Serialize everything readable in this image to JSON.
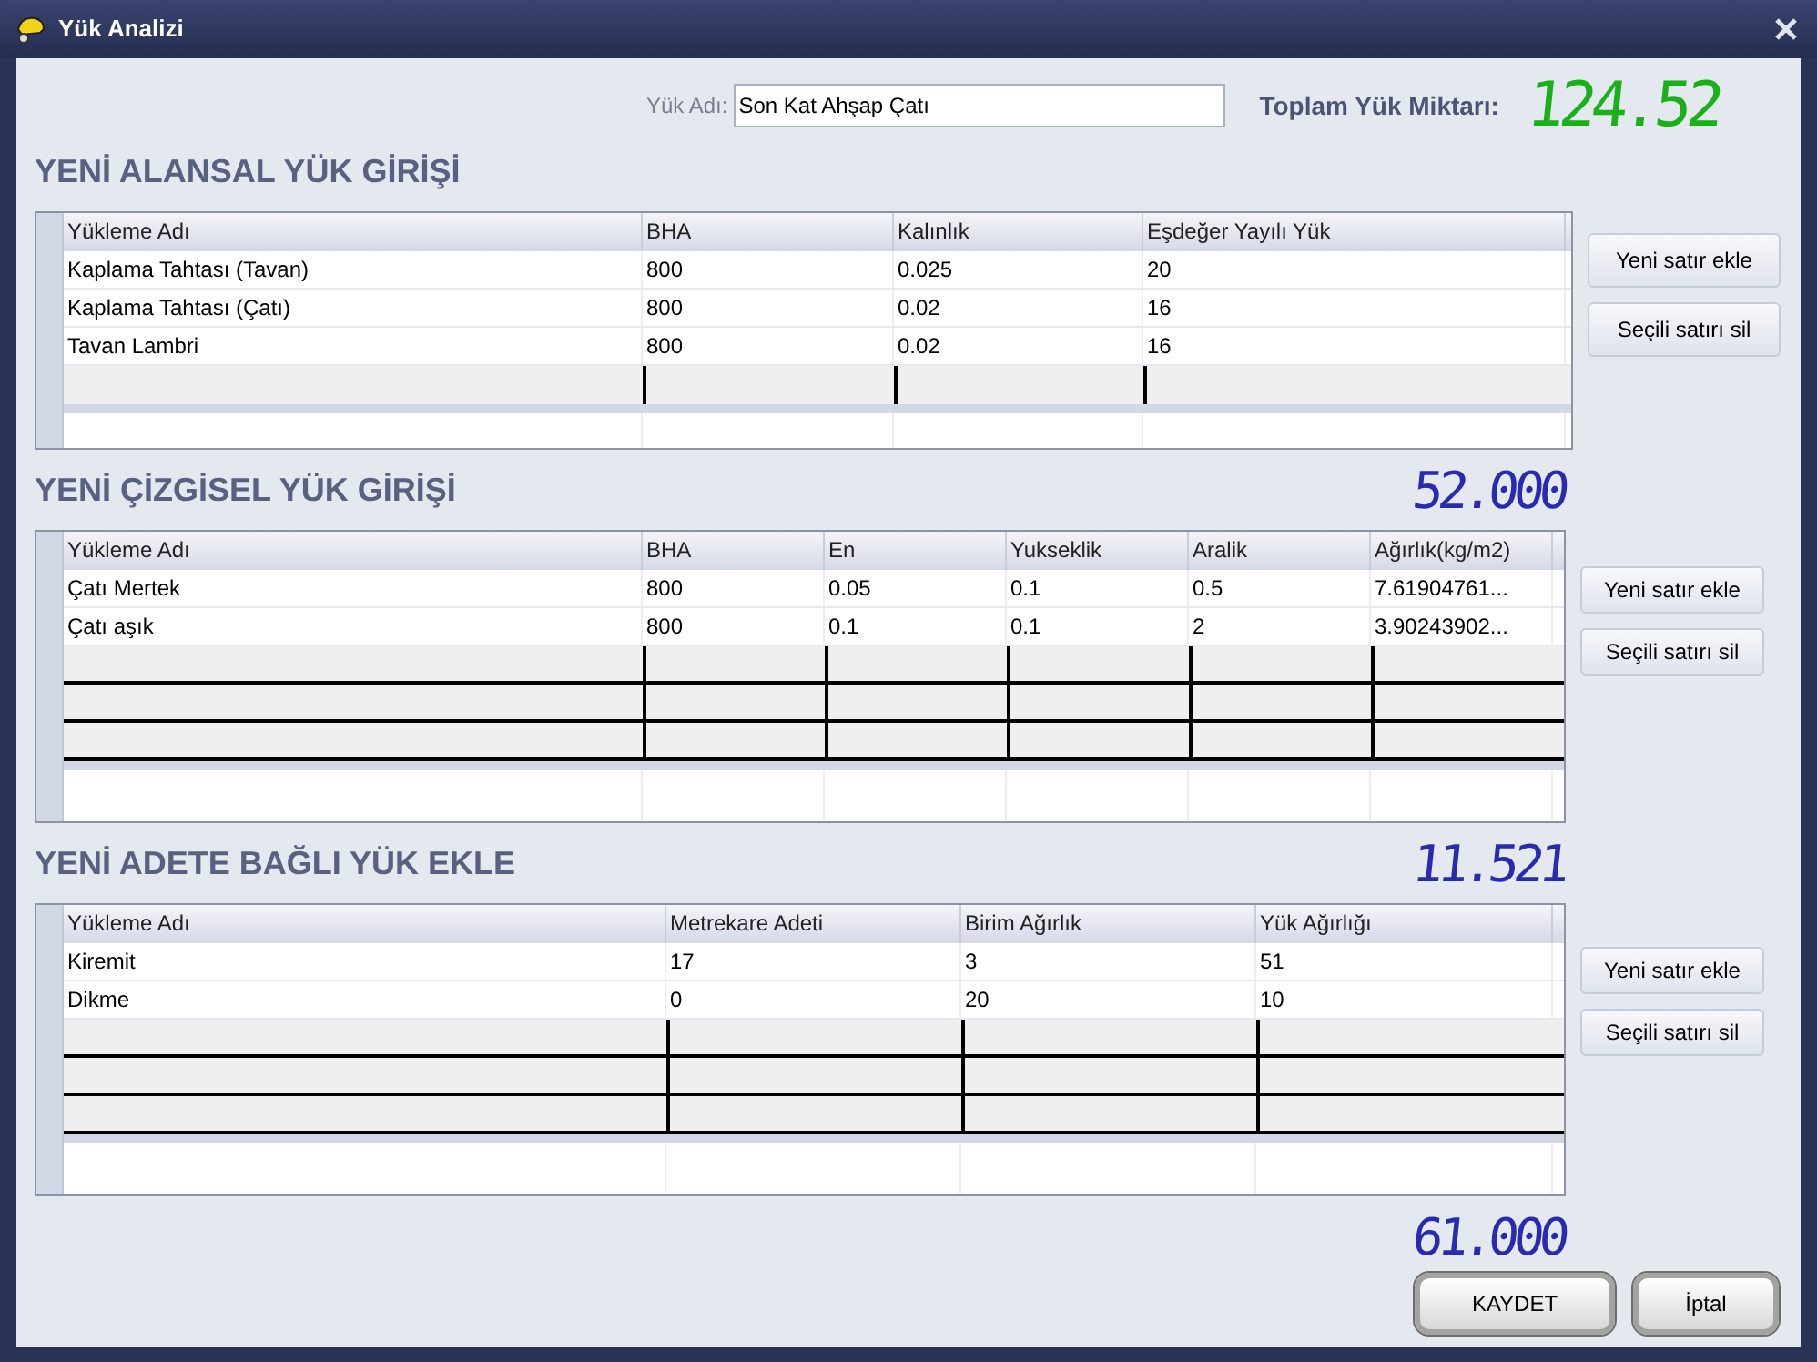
{
  "window": {
    "title": "Yük Analizi"
  },
  "header": {
    "name_label": "Yük Adı:",
    "name_value": "Son Kat Ahşap Çatı",
    "total_label": "Toplam Yük Miktarı:",
    "total_display": "124.52"
  },
  "sections": [
    {
      "kind": "area",
      "title": "YENİ ALANSAL YÜK GİRİŞİ",
      "columns": [
        "Yükleme Adı",
        "BHA",
        "Kalınlık",
        "Eşdeğer Yayılı Yük"
      ],
      "rows": [
        [
          "Kaplama Tahtası (Tavan)",
          "800",
          "0.025",
          "20"
        ],
        [
          "Kaplama Tahtası (Çatı)",
          "800",
          "0.02",
          "16"
        ],
        [
          "Tavan Lambri",
          "800",
          "0.02",
          "16"
        ]
      ],
      "buttons": [
        "Yeni satır ekle",
        "Seçili satırı sil"
      ],
      "total_display": "52.000"
    },
    {
      "kind": "line",
      "title": "YENİ ÇİZGİSEL YÜK GİRİŞİ",
      "columns": [
        "Yükleme Adı",
        "BHA",
        "En",
        "Yukseklik",
        "Aralik",
        "Ağırlık(kg/m2)"
      ],
      "rows": [
        [
          "Çatı Mertek",
          "800",
          "0.05",
          "0.1",
          "0.5",
          "7.61904761..."
        ],
        [
          "Çatı aşık",
          "800",
          "0.1",
          "0.1",
          "2",
          "3.90243902..."
        ]
      ],
      "buttons": [
        "Yeni satır ekle",
        "Seçili satırı sil"
      ],
      "total_display": "11.521"
    },
    {
      "kind": "count",
      "title": "YENİ ADETE BAĞLI YÜK EKLE",
      "columns": [
        "Yükleme Adı",
        "Metrekare Adeti",
        "Birim Ağırlık",
        "Yük Ağırlığı"
      ],
      "rows": [
        [
          "Kiremit",
          "17",
          "3",
          "51"
        ],
        [
          "Dikme",
          "0",
          "20",
          "10"
        ]
      ],
      "buttons": [
        "Yeni satır ekle",
        "Seçili satırı sil"
      ],
      "total_display": "61.000"
    }
  ],
  "footer_buttons": [
    "KAYDET",
    "İptal"
  ]
}
